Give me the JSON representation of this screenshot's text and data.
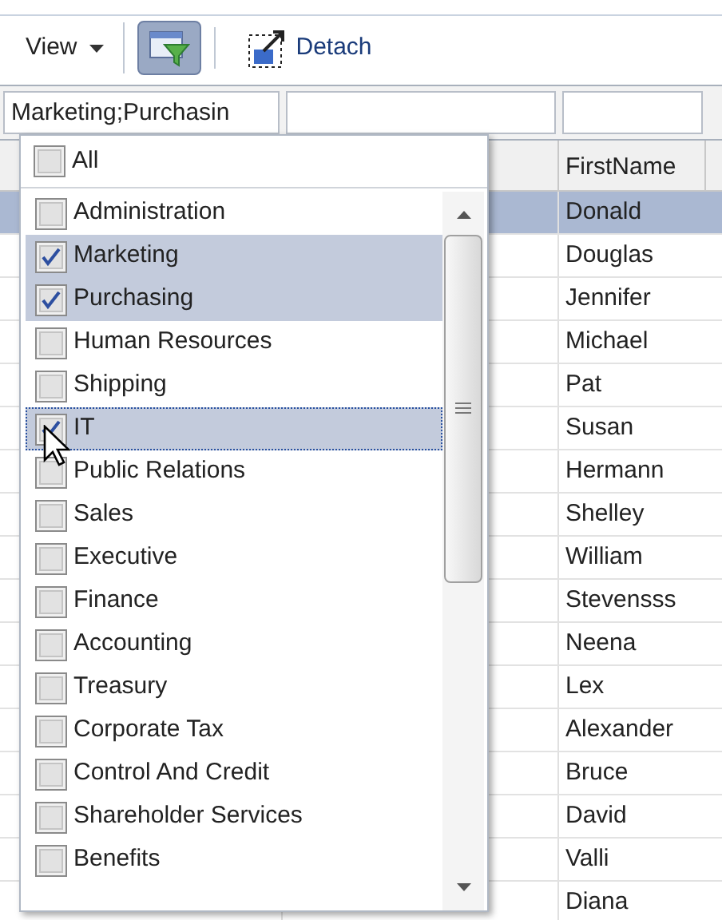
{
  "toolbar": {
    "view_menu": "View",
    "filter_button": {
      "selected": true
    },
    "detach_button": "Detach"
  },
  "filter_row": {
    "department_filter": "Marketing;Purchasin"
  },
  "table": {
    "columns": [
      "",
      "",
      "FirstName"
    ],
    "rows": [
      {
        "first_name": "Donald",
        "selected": true
      },
      {
        "first_name": "Douglas",
        "selected": false
      },
      {
        "first_name": "Jennifer",
        "selected": false
      },
      {
        "first_name": "Michael",
        "selected": false
      },
      {
        "first_name": "Pat",
        "selected": false
      },
      {
        "first_name": "Susan",
        "selected": false
      },
      {
        "first_name": "Hermann",
        "selected": false
      },
      {
        "first_name": "Shelley",
        "selected": false
      },
      {
        "first_name": "William",
        "selected": false
      },
      {
        "first_name": "Stevensss",
        "selected": false
      },
      {
        "first_name": "Neena",
        "selected": false
      },
      {
        "first_name": "Lex",
        "selected": false
      },
      {
        "first_name": "Alexander",
        "selected": false
      },
      {
        "first_name": "Bruce",
        "selected": false
      },
      {
        "first_name": "David",
        "selected": false
      },
      {
        "first_name": "Valli",
        "selected": false
      },
      {
        "first_name": "Diana",
        "selected": false
      }
    ]
  },
  "dropdown": {
    "all": {
      "label": "All",
      "checked": false
    },
    "items": [
      {
        "label": "Administration",
        "checked": false,
        "focused": false
      },
      {
        "label": "Marketing",
        "checked": true,
        "focused": false
      },
      {
        "label": "Purchasing",
        "checked": true,
        "focused": false
      },
      {
        "label": "Human Resources",
        "checked": false,
        "focused": false
      },
      {
        "label": "Shipping",
        "checked": false,
        "focused": false
      },
      {
        "label": "IT",
        "checked": true,
        "focused": true
      },
      {
        "label": "Public Relations",
        "checked": false,
        "focused": false
      },
      {
        "label": "Sales",
        "checked": false,
        "focused": false
      },
      {
        "label": "Executive",
        "checked": false,
        "focused": false
      },
      {
        "label": "Finance",
        "checked": false,
        "focused": false
      },
      {
        "label": "Accounting",
        "checked": false,
        "focused": false
      },
      {
        "label": "Treasury",
        "checked": false,
        "focused": false
      },
      {
        "label": "Corporate Tax",
        "checked": false,
        "focused": false
      },
      {
        "label": "Control And Credit",
        "checked": false,
        "focused": false
      },
      {
        "label": "Shareholder Services",
        "checked": false,
        "focused": false
      },
      {
        "label": "Benefits",
        "checked": false,
        "focused": false
      }
    ]
  }
}
